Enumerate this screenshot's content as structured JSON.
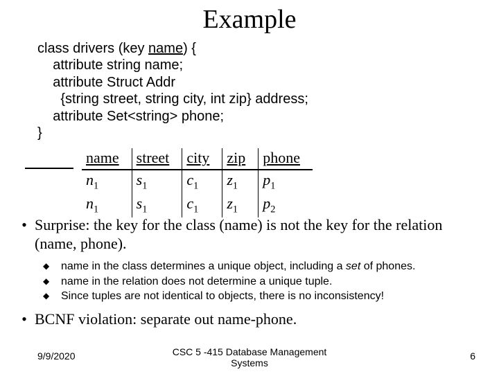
{
  "title": "Example",
  "code": {
    "l1a": "class drivers (key ",
    "l1b": "name",
    "l1c": ") {",
    "l2": "    attribute string name;",
    "l3": "    attribute Struct Addr",
    "l4": "      {string street, string city, int zip} address;",
    "l5": "    attribute Set<string> phone;",
    "l6": "}"
  },
  "table": {
    "h": {
      "c0": "name",
      "c1": "street",
      "c2": "city",
      "c3": "zip",
      "c4": "phone"
    },
    "r1": {
      "c0a": "n",
      "c0s": "1",
      "c1a": "s",
      "c1s": "1",
      "c2a": "c",
      "c2s": "1",
      "c3a": "z",
      "c3s": "1",
      "c4a": "p",
      "c4s": "1"
    },
    "r2": {
      "c0a": "n",
      "c0s": "1",
      "c1a": "s",
      "c1s": "1",
      "c2a": "c",
      "c2s": "1",
      "c3a": "z",
      "c3s": "1",
      "c4a": "p",
      "c4s": "2"
    }
  },
  "b1": "Surprise: the key for the class (name) is not the key for the relation (name, phone).",
  "sub": {
    "a1": "name",
    "a2": " in the class determines a unique object, including a ",
    "a3": "set",
    "a4": " of phones.",
    "b1": "name",
    "b2": " in the relation does not determine a unique tuple.",
    "c": "Since tuples are not identical to objects, there is no inconsistency!"
  },
  "b2": "BCNF violation: separate out name-phone.",
  "footer": {
    "date": "9/9/2020",
    "center1": "CSC 5 -415 Database Management",
    "center2": "Systems",
    "page": "6"
  }
}
